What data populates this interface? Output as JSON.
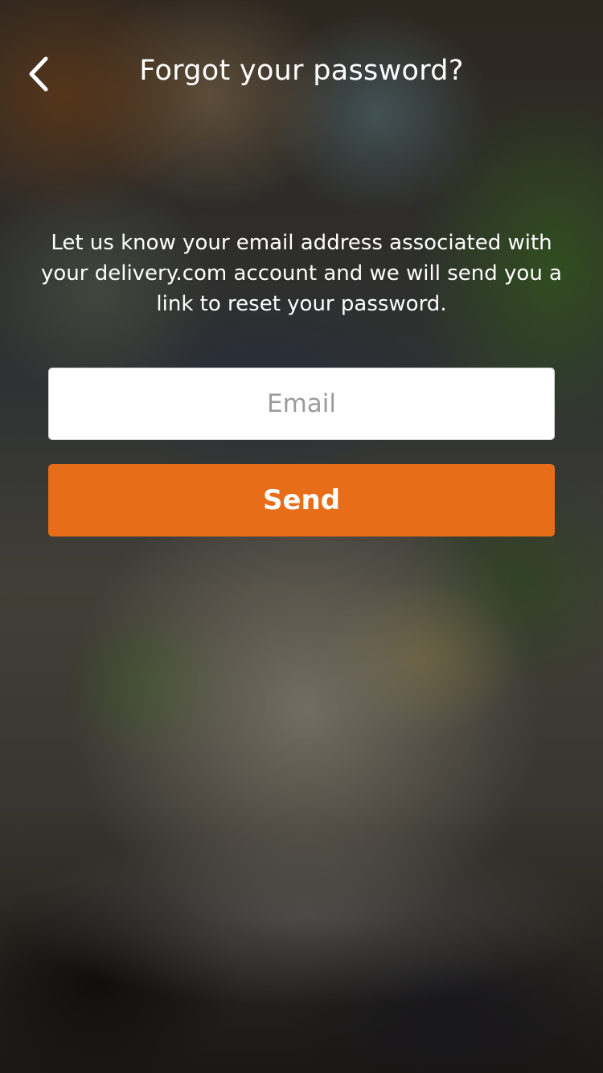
{
  "header": {
    "title": "Forgot your password?",
    "back_icon": "chevron-left-icon"
  },
  "main": {
    "description": "Let us know your email address associated with your delivery.com account and we will send you a link to reset your password.",
    "email": {
      "placeholder": "Email",
      "value": ""
    },
    "send_label": "Send"
  },
  "colors": {
    "accent": "#e86d18",
    "text": "#ffffff",
    "placeholder": "#9b9b9b"
  }
}
